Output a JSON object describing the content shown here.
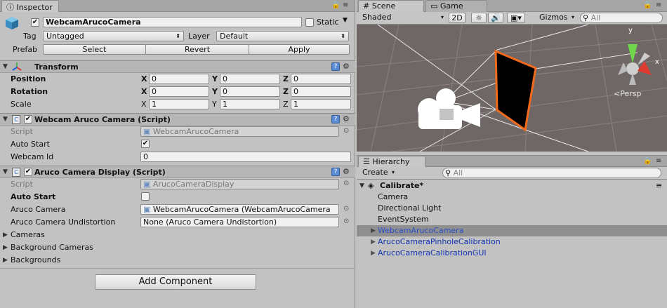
{
  "inspector": {
    "tab_label": "Inspector",
    "object": {
      "name": "WebcamArucoCamera",
      "active": true,
      "static_label": "Static",
      "static_checked": false,
      "tag_label": "Tag",
      "tag_value": "Untagged",
      "layer_label": "Layer",
      "layer_value": "Default",
      "prefab_label": "Prefab",
      "prefab_buttons": [
        "Select",
        "Revert",
        "Apply"
      ]
    },
    "transform": {
      "title": "Transform",
      "position_label": "Position",
      "rotation_label": "Rotation",
      "scale_label": "Scale",
      "axis_x": "X",
      "axis_y": "Y",
      "axis_z": "Z",
      "position": [
        "0",
        "0",
        "0"
      ],
      "rotation": [
        "0",
        "0",
        "0"
      ],
      "scale": [
        "1",
        "1",
        "1"
      ]
    },
    "webcam_script": {
      "title": "Webcam Aruco Camera (Script)",
      "script_label": "Script",
      "script_value": "WebcamArucoCamera",
      "auto_start_label": "Auto Start",
      "auto_start_checked": true,
      "webcam_id_label": "Webcam Id",
      "webcam_id_value": "0"
    },
    "display_script": {
      "title": "Aruco Camera Display (Script)",
      "script_label": "Script",
      "script_value": "ArucoCameraDisplay",
      "auto_start_label": "Auto Start",
      "auto_start_checked": false,
      "aruco_camera_label": "Aruco Camera",
      "aruco_camera_value": "WebcamArucoCamera (WebcamArucoCamera",
      "undistortion_label": "Aruco Camera Undistortion",
      "undistortion_value": "None (Aruco Camera Undistortion)",
      "cameras_label": "Cameras",
      "background_cameras_label": "Background Cameras",
      "backgrounds_label": "Backgrounds"
    },
    "add_component_label": "Add Component"
  },
  "scene": {
    "tab_scene": "Scene",
    "tab_game": "Game",
    "shading_mode": "Shaded",
    "mode_2d": "2D",
    "gizmos_label": "Gizmos",
    "search_placeholder": "All",
    "persp_label": "Persp",
    "gizmo_y": "y",
    "gizmo_x": "x"
  },
  "hierarchy": {
    "tab_label": "Hierarchy",
    "create_label": "Create",
    "search_placeholder": "All",
    "scene_name": "Calibrate*",
    "items": [
      {
        "label": "Camera",
        "expandable": false,
        "selected": false,
        "prefab": false
      },
      {
        "label": "Directional Light",
        "expandable": false,
        "selected": false,
        "prefab": false
      },
      {
        "label": "EventSystem",
        "expandable": false,
        "selected": false,
        "prefab": false
      },
      {
        "label": "WebcamArucoCamera",
        "expandable": true,
        "selected": true,
        "prefab": true
      },
      {
        "label": "ArucoCameraPinholeCalibration",
        "expandable": true,
        "selected": false,
        "prefab": true
      },
      {
        "label": "ArucoCameraCalibrationGUI",
        "expandable": true,
        "selected": false,
        "prefab": true
      }
    ]
  },
  "colors": {
    "panel_bg": "#c2c2c2",
    "scene_bg": "#6e6766",
    "selection_bg": "#8f8f8f",
    "prefab_text": "#1535b5",
    "selection_outline": "#f26b1d"
  }
}
